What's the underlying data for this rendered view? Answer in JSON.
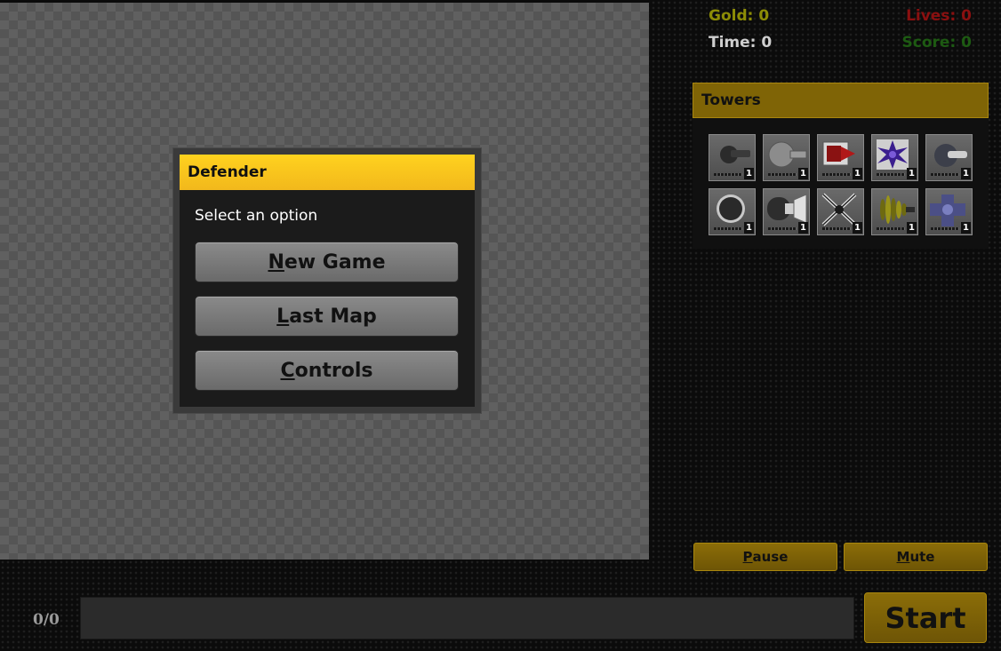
{
  "dialog": {
    "title": "Defender",
    "prompt": "Select an option",
    "buttons": [
      {
        "hotkey": "N",
        "rest": "ew Game"
      },
      {
        "hotkey": "L",
        "rest": "ast Map"
      },
      {
        "hotkey": "C",
        "rest": "ontrols"
      }
    ]
  },
  "stats": {
    "gold": "Gold: 0",
    "lives": "Lives: 0",
    "time": "Time: 0",
    "score": "Score: 0",
    "colors": {
      "gold": "#8c8c06",
      "lives": "#8a1010",
      "time": "#cfcfcf",
      "score": "#1d5a12"
    }
  },
  "towers": {
    "header": "Towers",
    "items": [
      {
        "icon": "cannon-tower-icon",
        "level": "1"
      },
      {
        "icon": "big-cannon-tower-icon",
        "level": "1"
      },
      {
        "icon": "missile-tower-icon",
        "level": "1"
      },
      {
        "icon": "star-tower-icon",
        "level": "1"
      },
      {
        "icon": "pulse-tower-icon",
        "level": "1"
      },
      {
        "icon": "bomb-tower-icon",
        "level": "1"
      },
      {
        "icon": "horn-tower-icon",
        "level": "1"
      },
      {
        "icon": "spike-tower-icon",
        "level": "1"
      },
      {
        "icon": "coil-tower-icon",
        "level": "1"
      },
      {
        "icon": "cross-tower-icon",
        "level": "1"
      }
    ]
  },
  "controls": {
    "pause": {
      "hotkey": "P",
      "rest": "ause"
    },
    "mute": {
      "hotkey": "M",
      "rest": "ute"
    }
  },
  "bottom": {
    "wave_count": "0/0",
    "start_label": "Start"
  }
}
